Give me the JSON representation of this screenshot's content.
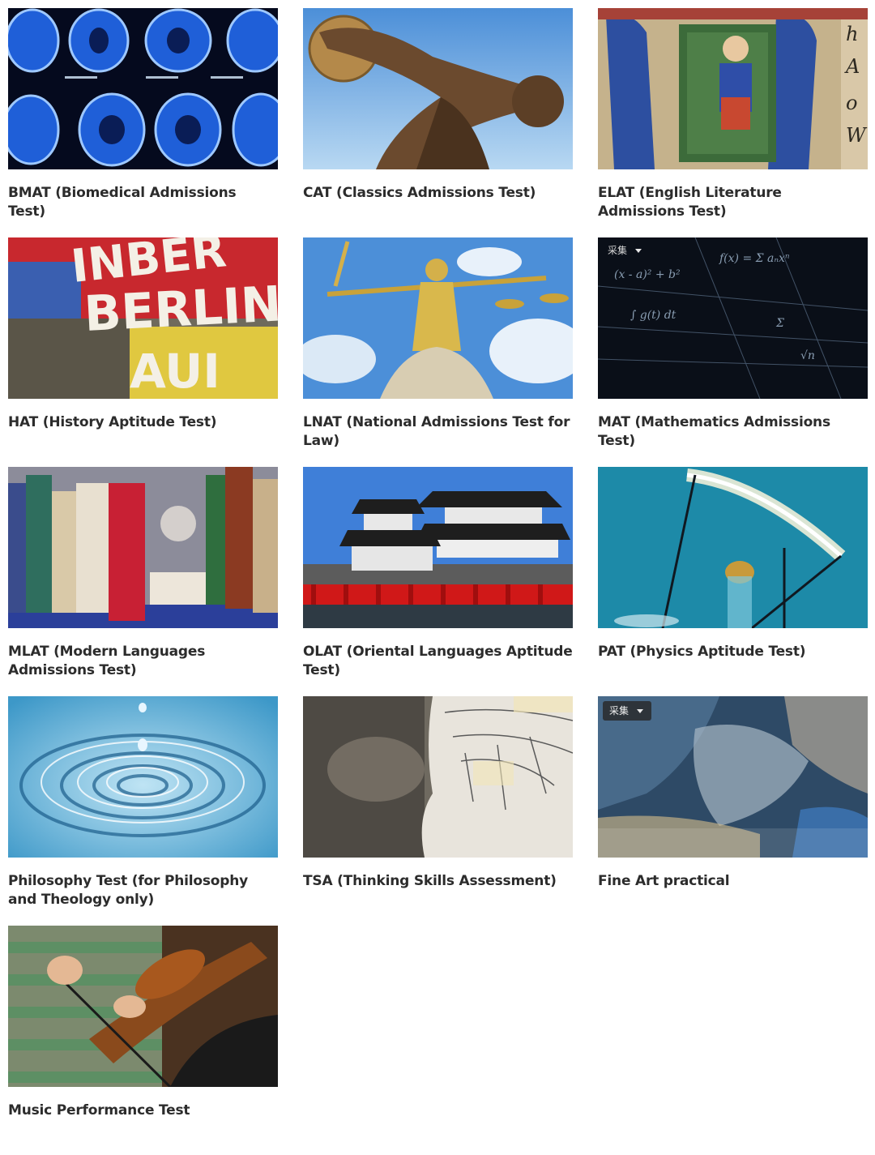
{
  "tests": [
    {
      "title": "BMAT (Biomedical Admissions Test)",
      "image": "brain-scan-image"
    },
    {
      "title": "CAT (Classics Admissions Test)",
      "image": "discobolus-statue-image"
    },
    {
      "title": "ELAT (English Literature Admissions Test)",
      "image": "illuminated-manuscript-image"
    },
    {
      "title": "HAT (History Aptitude Test)",
      "image": "berlin-wall-graffiti-image"
    },
    {
      "title": "LNAT (National Admissions Test for Law)",
      "image": "lady-justice-statue-image"
    },
    {
      "title": "MAT (Mathematics Admissions Test)",
      "image": "math-formulas-image"
    },
    {
      "title": "MLAT (Modern Languages Admissions Test)",
      "image": "book-shelf-image"
    },
    {
      "title": "OLAT (Oriental Languages Aptitude Test)",
      "image": "japanese-castle-image"
    },
    {
      "title": "PAT (Physics Aptitude Test)",
      "image": "light-bulb-filament-image"
    },
    {
      "title": "Philosophy Test (for Philosophy and Theology only)",
      "image": "water-ripple-image"
    },
    {
      "title": "TSA (Thinking Skills Assessment)",
      "image": "phrenology-head-image"
    },
    {
      "title": "Fine Art practical",
      "image": "abstract-painting-image"
    },
    {
      "title": "Music Performance Test",
      "image": "violin-player-image"
    }
  ],
  "collect_label": "采集",
  "colors": {
    "title_text": "#2c2c2c",
    "background": "#ffffff"
  }
}
